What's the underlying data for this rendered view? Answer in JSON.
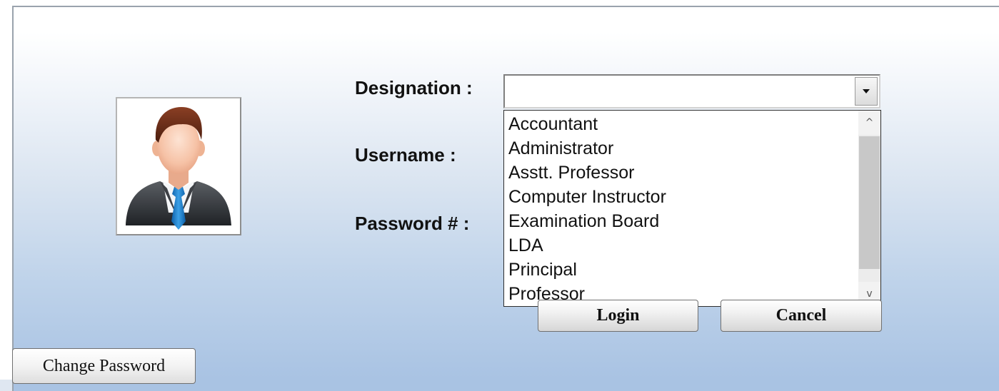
{
  "form": {
    "designation_label": "Designation :",
    "username_label": "Username :",
    "password_label": "Password # :",
    "designation_value": ""
  },
  "avatar": {
    "icon": "user-avatar-icon"
  },
  "dropdown": {
    "options": [
      "Accountant",
      "Administrator",
      "Asstt. Professor",
      "Computer Instructor",
      "Examination Board",
      "LDA",
      "Principal",
      "Professor"
    ],
    "scroll_up_glyph": "^",
    "scroll_down_glyph": "v"
  },
  "buttons": {
    "login": "Login",
    "cancel": "Cancel",
    "change_password": "Change Password"
  },
  "colors": {
    "panel_gradient_bottom": "#a9c3e3",
    "dropdown_border": "#2e2e2e"
  }
}
